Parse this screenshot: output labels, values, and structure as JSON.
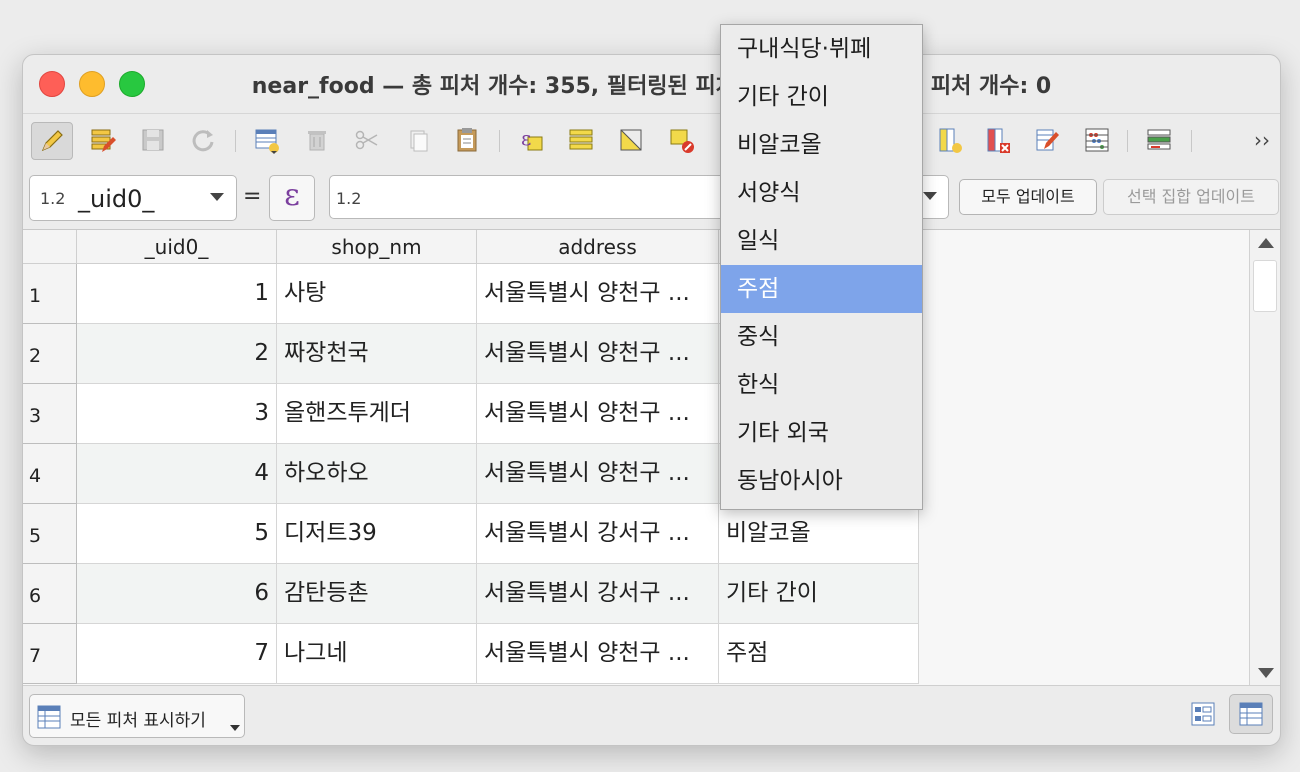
{
  "window": {
    "title": "near_food — 총 피처 개수: 355, 필터링된 피처 개수: 355, 선택한 피처 개수: 0"
  },
  "toolbar": {
    "buttons": [
      {
        "name": "toggle-editing",
        "icon": "pencil-icon"
      },
      {
        "name": "multi-edit",
        "icon": "multi-edit-icon"
      },
      {
        "name": "save-edits",
        "icon": "save-icon"
      },
      {
        "name": "reload",
        "icon": "refresh-icon"
      },
      {
        "name": "add-feature",
        "icon": "add-feature-icon"
      },
      {
        "name": "delete-features",
        "icon": "trash-icon"
      },
      {
        "name": "cut",
        "icon": "scissors-icon"
      },
      {
        "name": "copy",
        "icon": "copy-icon"
      },
      {
        "name": "paste",
        "icon": "paste-icon"
      },
      {
        "name": "select-by-expression",
        "icon": "expression-select-icon"
      },
      {
        "name": "select-all",
        "icon": "select-all-icon"
      },
      {
        "name": "invert-selection",
        "icon": "invert-selection-icon"
      },
      {
        "name": "deselect-all",
        "icon": "deselect-icon"
      },
      {
        "name": "new-field",
        "icon": "new-field-icon"
      },
      {
        "name": "delete-field",
        "icon": "delete-field-icon"
      },
      {
        "name": "field-calculator",
        "icon": "field-calculator-icon"
      },
      {
        "name": "conditional-formatting",
        "icon": "abacus-icon"
      },
      {
        "name": "dock",
        "icon": "dock-icon"
      }
    ],
    "overflow": "››"
  },
  "expression_bar": {
    "field_type": "1.2",
    "field_name": "_uid0_",
    "equals": "=",
    "epsilon": "ε",
    "input_type": "1.2",
    "update_all": "모두 업데이트",
    "update_selected": "선택 집합 업데이트"
  },
  "table": {
    "columns": [
      "_uid0_",
      "shop_nm",
      "address"
    ],
    "rows": [
      {
        "n": "1",
        "uid": "1",
        "shop": "사탕",
        "addr": "서울특별시 양천구 ...",
        "cat": ""
      },
      {
        "n": "2",
        "uid": "2",
        "shop": "짜장천국",
        "addr": "서울특별시 양천구 ...",
        "cat": ""
      },
      {
        "n": "3",
        "uid": "3",
        "shop": "올핸즈투게더",
        "addr": "서울특별시 양천구 ...",
        "cat": ""
      },
      {
        "n": "4",
        "uid": "4",
        "shop": "하오하오",
        "addr": "서울특별시 양천구 ...",
        "cat": ""
      },
      {
        "n": "5",
        "uid": "5",
        "shop": "디저트39",
        "addr": "서울특별시 강서구 ...",
        "cat": "비알코올"
      },
      {
        "n": "6",
        "uid": "6",
        "shop": "감탄등촌",
        "addr": "서울특별시 강서구 ...",
        "cat": "기타 간이"
      },
      {
        "n": "7",
        "uid": "7",
        "shop": "나그네",
        "addr": "서울특별시 양천구 ...",
        "cat": "주점"
      }
    ]
  },
  "dropdown": {
    "items": [
      "구내식당·뷔페",
      "기타 간이",
      "비알코올",
      "서양식",
      "일식",
      "주점",
      "중식",
      "한식",
      "기타 외국",
      "동남아시아"
    ],
    "selected": "주점"
  },
  "bottom": {
    "show_all": "모든 피처 표시하기"
  },
  "colors": {
    "selection": "#7ea4ea",
    "close": "#fe5f57",
    "minimize": "#febc2e",
    "maximize": "#28c840"
  }
}
